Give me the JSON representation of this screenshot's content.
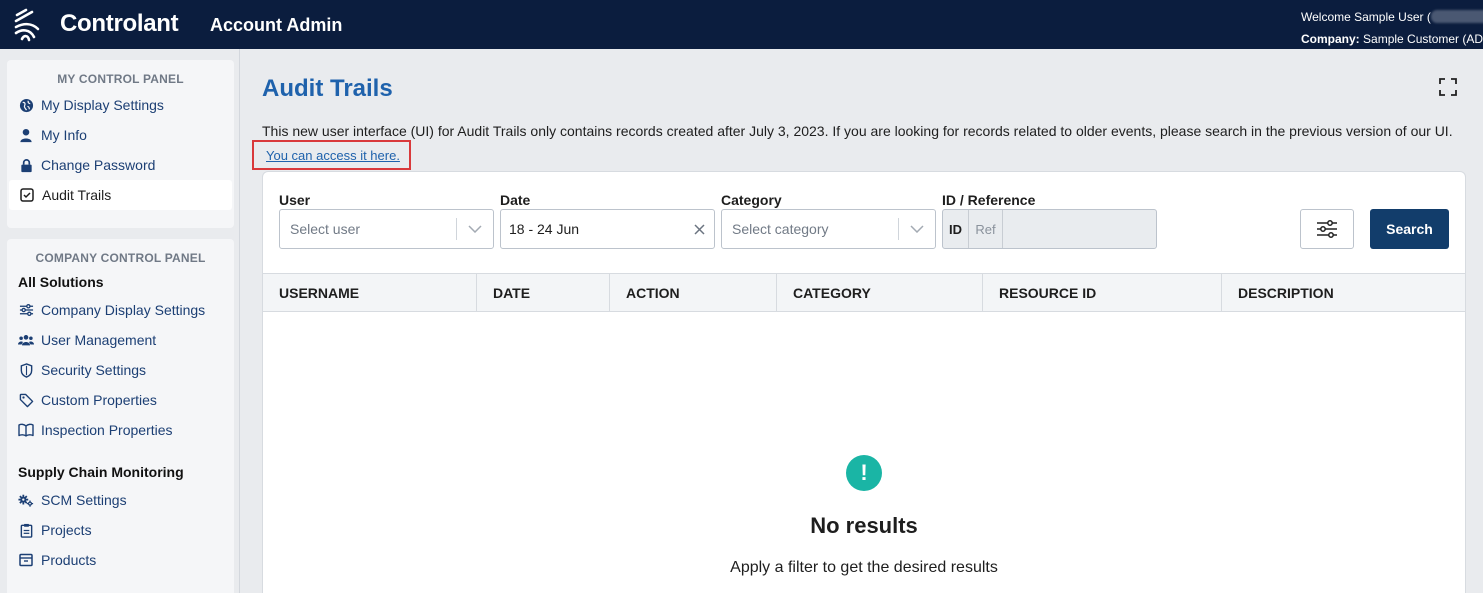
{
  "header": {
    "brand": "Controlant",
    "app_title": "Account Admin",
    "welcome_label": "Welcome Sample User (",
    "company_label": "Company:",
    "company_value": "Sample Customer (ADM"
  },
  "sidebar": {
    "my_panel_title": "MY CONTROL PANEL",
    "my_items": [
      {
        "label": "My Display Settings",
        "icon": "globe-icon"
      },
      {
        "label": "My Info",
        "icon": "person-icon"
      },
      {
        "label": "Change Password",
        "icon": "lock-icon"
      },
      {
        "label": "Audit Trails",
        "icon": "checkbox-icon",
        "active": true
      }
    ],
    "company_panel_title": "COMPANY CONTROL PANEL",
    "section_all": "All Solutions",
    "all_items": [
      {
        "label": "Company Display Settings",
        "icon": "sliders-icon"
      },
      {
        "label": "User Management",
        "icon": "users-icon"
      },
      {
        "label": "Security Settings",
        "icon": "shield-icon"
      },
      {
        "label": "Custom Properties",
        "icon": "tag-icon"
      },
      {
        "label": "Inspection Properties",
        "icon": "book-icon"
      }
    ],
    "section_scm": "Supply Chain Monitoring",
    "scm_items": [
      {
        "label": "SCM Settings",
        "icon": "gears-icon"
      },
      {
        "label": "Projects",
        "icon": "clipboard-icon"
      },
      {
        "label": "Products",
        "icon": "box-icon"
      }
    ]
  },
  "main": {
    "title": "Audit Trails",
    "info_text": "This new user interface (UI) for Audit Trails only contains records created after July 3, 2023. If you are looking for records related to older events, please search in the previous version of our UI.",
    "access_link": "You can access it here.",
    "filters": {
      "user_label": "User",
      "user_placeholder": "Select user",
      "date_label": "Date",
      "date_value": "18 - 24 Jun",
      "category_label": "Category",
      "category_placeholder": "Select category",
      "idref_label": "ID / Reference",
      "id_toggle": "ID",
      "ref_toggle": "Ref",
      "search_button": "Search"
    },
    "table": {
      "columns": [
        "USERNAME",
        "DATE",
        "ACTION",
        "CATEGORY",
        "RESOURCE ID",
        "DESCRIPTION"
      ]
    },
    "empty": {
      "icon_glyph": "!",
      "title": "No results",
      "subtitle": "Apply a filter to get the desired results"
    }
  },
  "colors": {
    "topbar": "#0b1d3e",
    "accent_blue": "#1f62ac",
    "search_button": "#123d6b",
    "empty_icon": "#1ab5a5",
    "highlight_border": "#d9393b"
  }
}
